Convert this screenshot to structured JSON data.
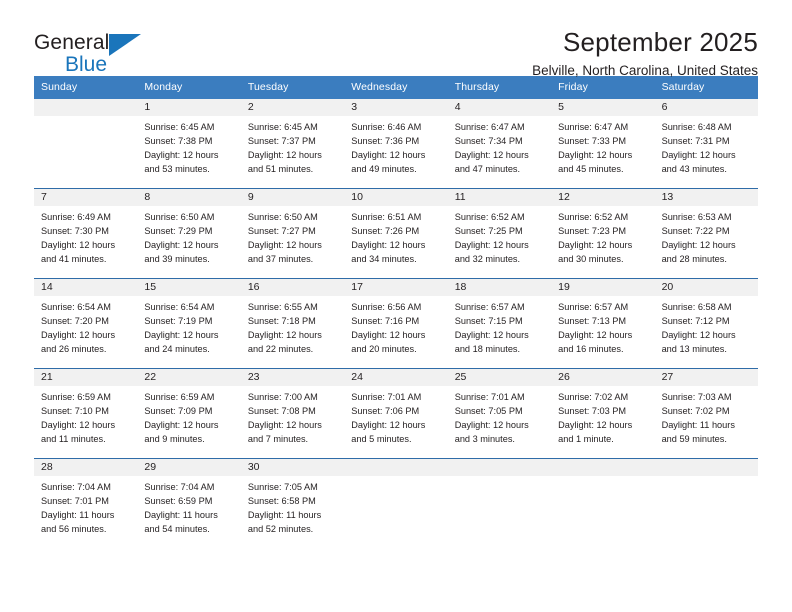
{
  "brand": {
    "name_top": "General",
    "name_bottom": "Blue"
  },
  "header": {
    "title": "September 2025",
    "subtitle": "Belville, North Carolina, United States"
  },
  "colors": {
    "header_blue": "#3b7dbf",
    "rule_blue": "#2f6ca8",
    "daynum_band": "#f1f1f1",
    "brand_blue": "#1a75bb",
    "text": "#231f20"
  },
  "weekdays": [
    "Sunday",
    "Monday",
    "Tuesday",
    "Wednesday",
    "Thursday",
    "Friday",
    "Saturday"
  ],
  "weeks": [
    [
      {
        "day": "",
        "lines": []
      },
      {
        "day": "1",
        "lines": [
          "Sunrise: 6:45 AM",
          "Sunset: 7:38 PM",
          "Daylight: 12 hours",
          "and 53 minutes."
        ]
      },
      {
        "day": "2",
        "lines": [
          "Sunrise: 6:45 AM",
          "Sunset: 7:37 PM",
          "Daylight: 12 hours",
          "and 51 minutes."
        ]
      },
      {
        "day": "3",
        "lines": [
          "Sunrise: 6:46 AM",
          "Sunset: 7:36 PM",
          "Daylight: 12 hours",
          "and 49 minutes."
        ]
      },
      {
        "day": "4",
        "lines": [
          "Sunrise: 6:47 AM",
          "Sunset: 7:34 PM",
          "Daylight: 12 hours",
          "and 47 minutes."
        ]
      },
      {
        "day": "5",
        "lines": [
          "Sunrise: 6:47 AM",
          "Sunset: 7:33 PM",
          "Daylight: 12 hours",
          "and 45 minutes."
        ]
      },
      {
        "day": "6",
        "lines": [
          "Sunrise: 6:48 AM",
          "Sunset: 7:31 PM",
          "Daylight: 12 hours",
          "and 43 minutes."
        ]
      }
    ],
    [
      {
        "day": "7",
        "lines": [
          "Sunrise: 6:49 AM",
          "Sunset: 7:30 PM",
          "Daylight: 12 hours",
          "and 41 minutes."
        ]
      },
      {
        "day": "8",
        "lines": [
          "Sunrise: 6:50 AM",
          "Sunset: 7:29 PM",
          "Daylight: 12 hours",
          "and 39 minutes."
        ]
      },
      {
        "day": "9",
        "lines": [
          "Sunrise: 6:50 AM",
          "Sunset: 7:27 PM",
          "Daylight: 12 hours",
          "and 37 minutes."
        ]
      },
      {
        "day": "10",
        "lines": [
          "Sunrise: 6:51 AM",
          "Sunset: 7:26 PM",
          "Daylight: 12 hours",
          "and 34 minutes."
        ]
      },
      {
        "day": "11",
        "lines": [
          "Sunrise: 6:52 AM",
          "Sunset: 7:25 PM",
          "Daylight: 12 hours",
          "and 32 minutes."
        ]
      },
      {
        "day": "12",
        "lines": [
          "Sunrise: 6:52 AM",
          "Sunset: 7:23 PM",
          "Daylight: 12 hours",
          "and 30 minutes."
        ]
      },
      {
        "day": "13",
        "lines": [
          "Sunrise: 6:53 AM",
          "Sunset: 7:22 PM",
          "Daylight: 12 hours",
          "and 28 minutes."
        ]
      }
    ],
    [
      {
        "day": "14",
        "lines": [
          "Sunrise: 6:54 AM",
          "Sunset: 7:20 PM",
          "Daylight: 12 hours",
          "and 26 minutes."
        ]
      },
      {
        "day": "15",
        "lines": [
          "Sunrise: 6:54 AM",
          "Sunset: 7:19 PM",
          "Daylight: 12 hours",
          "and 24 minutes."
        ]
      },
      {
        "day": "16",
        "lines": [
          "Sunrise: 6:55 AM",
          "Sunset: 7:18 PM",
          "Daylight: 12 hours",
          "and 22 minutes."
        ]
      },
      {
        "day": "17",
        "lines": [
          "Sunrise: 6:56 AM",
          "Sunset: 7:16 PM",
          "Daylight: 12 hours",
          "and 20 minutes."
        ]
      },
      {
        "day": "18",
        "lines": [
          "Sunrise: 6:57 AM",
          "Sunset: 7:15 PM",
          "Daylight: 12 hours",
          "and 18 minutes."
        ]
      },
      {
        "day": "19",
        "lines": [
          "Sunrise: 6:57 AM",
          "Sunset: 7:13 PM",
          "Daylight: 12 hours",
          "and 16 minutes."
        ]
      },
      {
        "day": "20",
        "lines": [
          "Sunrise: 6:58 AM",
          "Sunset: 7:12 PM",
          "Daylight: 12 hours",
          "and 13 minutes."
        ]
      }
    ],
    [
      {
        "day": "21",
        "lines": [
          "Sunrise: 6:59 AM",
          "Sunset: 7:10 PM",
          "Daylight: 12 hours",
          "and 11 minutes."
        ]
      },
      {
        "day": "22",
        "lines": [
          "Sunrise: 6:59 AM",
          "Sunset: 7:09 PM",
          "Daylight: 12 hours",
          "and 9 minutes."
        ]
      },
      {
        "day": "23",
        "lines": [
          "Sunrise: 7:00 AM",
          "Sunset: 7:08 PM",
          "Daylight: 12 hours",
          "and 7 minutes."
        ]
      },
      {
        "day": "24",
        "lines": [
          "Sunrise: 7:01 AM",
          "Sunset: 7:06 PM",
          "Daylight: 12 hours",
          "and 5 minutes."
        ]
      },
      {
        "day": "25",
        "lines": [
          "Sunrise: 7:01 AM",
          "Sunset: 7:05 PM",
          "Daylight: 12 hours",
          "and 3 minutes."
        ]
      },
      {
        "day": "26",
        "lines": [
          "Sunrise: 7:02 AM",
          "Sunset: 7:03 PM",
          "Daylight: 12 hours",
          "and 1 minute."
        ]
      },
      {
        "day": "27",
        "lines": [
          "Sunrise: 7:03 AM",
          "Sunset: 7:02 PM",
          "Daylight: 11 hours",
          "and 59 minutes."
        ]
      }
    ],
    [
      {
        "day": "28",
        "lines": [
          "Sunrise: 7:04 AM",
          "Sunset: 7:01 PM",
          "Daylight: 11 hours",
          "and 56 minutes."
        ]
      },
      {
        "day": "29",
        "lines": [
          "Sunrise: 7:04 AM",
          "Sunset: 6:59 PM",
          "Daylight: 11 hours",
          "and 54 minutes."
        ]
      },
      {
        "day": "30",
        "lines": [
          "Sunrise: 7:05 AM",
          "Sunset: 6:58 PM",
          "Daylight: 11 hours",
          "and 52 minutes."
        ]
      },
      {
        "day": "",
        "lines": []
      },
      {
        "day": "",
        "lines": []
      },
      {
        "day": "",
        "lines": []
      },
      {
        "day": "",
        "lines": []
      }
    ]
  ]
}
